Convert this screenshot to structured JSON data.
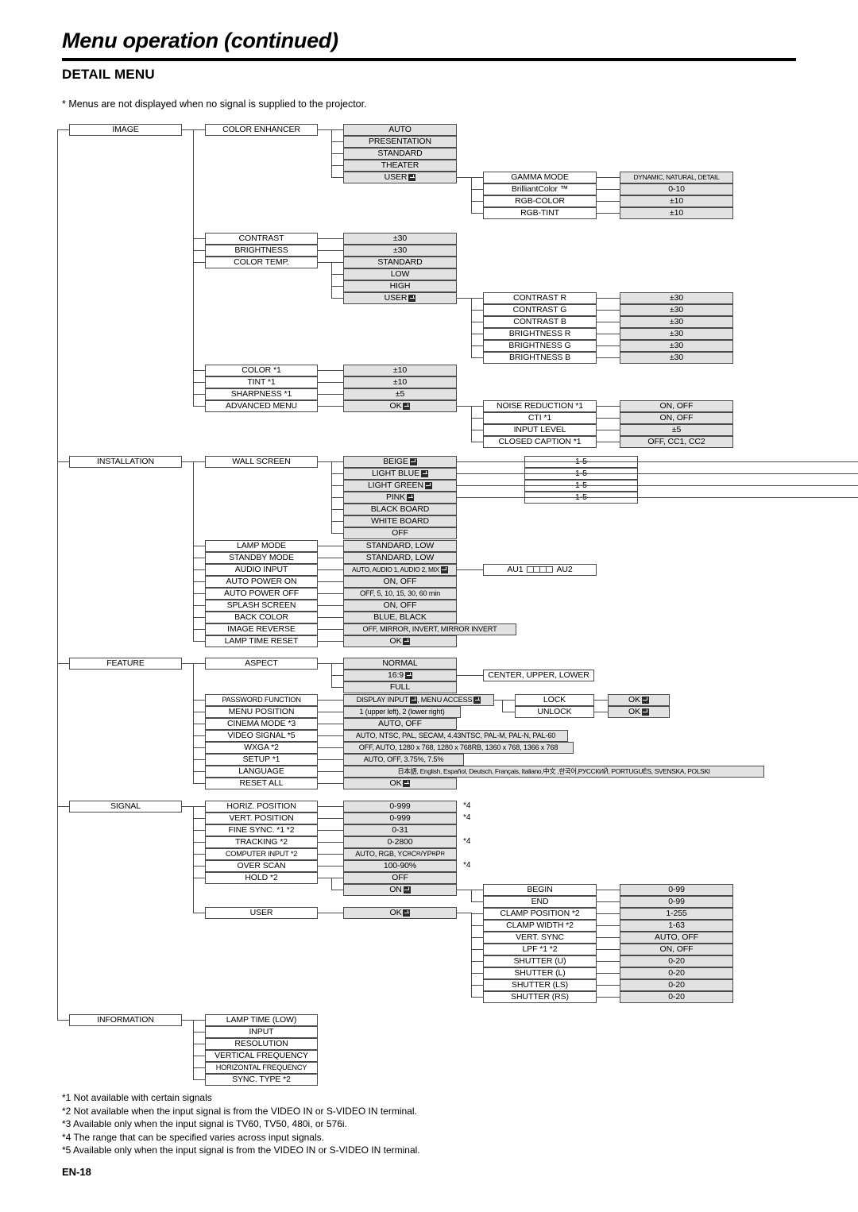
{
  "header": {
    "title": "Menu operation (continued)",
    "section": "DETAIL MENU",
    "note": "* Menus are not displayed when no signal is supplied to the projector."
  },
  "footer": {
    "page_number": "EN-18"
  },
  "footnotes": [
    "*1 Not available with certain signals",
    "*2 Not available when the input signal is from the VIDEO IN or S-VIDEO IN terminal.",
    "*3 Available only when the input signal is TV60, TV50, 480i, or 576i.",
    "*4 The range that can be specified varies across input signals.",
    "*5 Available only when the input signal is from the VIDEO IN or S-VIDEO IN terminal."
  ],
  "menus": {
    "image": {
      "label": "IMAGE",
      "items": {
        "color_enhancer": "COLOR ENHANCER",
        "contrast": "CONTRAST",
        "brightness": "BRIGHTNESS",
        "color_temp": "COLOR TEMP.",
        "color": "COLOR *1",
        "tint": "TINT *1",
        "sharpness": "SHARPNESS *1",
        "advanced_menu": "ADVANCED MENU"
      },
      "color_enhancer_options": [
        "AUTO",
        "PRESENTATION",
        "STANDARD",
        "THEATER",
        "USER"
      ],
      "color_enhancer_user": {
        "items": [
          "GAMMA MODE",
          "BrilliantColor ™",
          "RGB-COLOR",
          "RGB-TINT"
        ],
        "values": [
          "DYNAMIC, NATURAL, DETAIL",
          "0-10",
          "±10",
          "±10"
        ]
      },
      "contrast_value": "±30",
      "brightness_value": "±30",
      "color_temp_options": [
        "STANDARD",
        "LOW",
        "HIGH",
        "USER"
      ],
      "color_temp_user": {
        "items": [
          "CONTRAST R",
          "CONTRAST G",
          "CONTRAST B",
          "BRIGHTNESS R",
          "BRIGHTNESS G",
          "BRIGHTNESS B"
        ],
        "values": [
          "±30",
          "±30",
          "±30",
          "±30",
          "±30",
          "±30"
        ]
      },
      "color_value": "±10",
      "tint_value": "±10",
      "sharpness_value": "±5",
      "advanced_menu_value": "OK",
      "advanced_menu_sub": {
        "items": [
          "NOISE REDUCTION *1",
          "CTI *1",
          "INPUT LEVEL",
          "CLOSED CAPTION *1"
        ],
        "values": [
          "ON, OFF",
          "ON, OFF",
          "±5",
          "OFF, CC1, CC2"
        ]
      }
    },
    "installation": {
      "label": "INSTALLATION",
      "items": {
        "wall_screen": "WALL SCREEN",
        "lamp_mode": "LAMP MODE",
        "standby_mode": "STANDBY MODE",
        "audio_input": "AUDIO INPUT",
        "auto_power_on": "AUTO POWER ON",
        "auto_power_off": "AUTO POWER OFF",
        "splash_screen": "SPLASH SCREEN",
        "back_color": "BACK COLOR",
        "image_reverse": "IMAGE REVERSE",
        "lamp_time_reset": "LAMP TIME RESET"
      },
      "wall_screen_options": [
        "BEIGE",
        "LIGHT BLUE",
        "LIGHT GREEN",
        "PINK",
        "BLACK BOARD",
        "WHITE BOARD",
        "OFF"
      ],
      "wall_screen_levels": [
        "1-5",
        "1-5",
        "1-5",
        "1-5"
      ],
      "values": {
        "lamp_mode": "STANDARD, LOW",
        "standby_mode": "STANDARD, LOW",
        "audio_input": "AUTO, AUDIO 1, AUDIO 2, MIX",
        "audio_input_slider": {
          "left": "AU1",
          "right": "AU2"
        },
        "auto_power_on": "ON, OFF",
        "auto_power_off": "OFF, 5, 10, 15, 30, 60 min",
        "splash_screen": "ON, OFF",
        "back_color": "BLUE, BLACK",
        "image_reverse": "OFF, MIRROR, INVERT, MIRROR INVERT",
        "lamp_time_reset": "OK"
      }
    },
    "feature": {
      "label": "FEATURE",
      "items": {
        "aspect": "ASPECT",
        "password_function": "PASSWORD FUNCTION",
        "menu_position": "MENU POSITION",
        "cinema_mode": "CINEMA MODE *3",
        "video_signal": "VIDEO SIGNAL *5",
        "wxga": "WXGA *2",
        "setup": "SETUP *1",
        "language": "LANGUAGE",
        "reset_all": "RESET ALL"
      },
      "aspect_options": [
        "NORMAL",
        "16:9",
        "FULL"
      ],
      "aspect_169_sub": "CENTER, UPPER, LOWER",
      "values": {
        "password_function": "DISPLAY INPUT ⏎, MENU ACCESS ⏎",
        "password_function_part1": "DISPLAY INPUT",
        "password_function_part2": ", MENU ACCESS",
        "menu_position": "1 (upper left),  2 (lower right)",
        "cinema_mode": "AUTO, OFF",
        "video_signal": "AUTO, NTSC, PAL, SECAM, 4.43NTSC, PAL-M, PAL-N, PAL-60",
        "wxga": "OFF, AUTO, 1280 x 768, 1280 x 768RB, 1360 x 768, 1366 x 768",
        "setup": "AUTO, OFF, 3.75%, 7.5%",
        "language": "日本語, English, Español, Deutsch, Français, Italiano,中文 ,한국어,РУССКИЙ, PORTUGUÊS, SVENSKA, POLSKI",
        "reset_all": "OK"
      },
      "password_sub": {
        "items": [
          "LOCK",
          "UNLOCK"
        ],
        "values": [
          "OK",
          "OK"
        ]
      }
    },
    "signal": {
      "label": "SIGNAL",
      "items": {
        "horiz_position": "HORIZ. POSITION",
        "vert_position": "VERT. POSITION",
        "fine_sync": "FINE SYNC. *1 *2",
        "tracking": "TRACKING *2",
        "computer_input": "COMPUTER INPUT *2",
        "over_scan": "OVER SCAN",
        "hold": "HOLD *2",
        "user": "USER"
      },
      "values": {
        "horiz_position": "0-999",
        "vert_position": "0-999",
        "fine_sync": "0-31",
        "tracking": "0-2800",
        "computer_input": "AUTO, RGB, YCBCR/YPBPR",
        "over_scan": "100-90%",
        "hold_off": "OFF",
        "hold_on": "ON",
        "user": "OK"
      },
      "markers": {
        "horiz_position": "*4",
        "vert_position": "*4",
        "tracking": "*4",
        "over_scan": "*4"
      },
      "hold_on_sub": {
        "items": [
          "BEGIN",
          "END"
        ],
        "values": [
          "0-99",
          "0-99"
        ]
      },
      "user_sub": {
        "items": [
          "CLAMP POSITION *2",
          "CLAMP WIDTH *2",
          "VERT. SYNC",
          "LPF *1 *2",
          "SHUTTER (U)",
          "SHUTTER (L)",
          "SHUTTER (LS)",
          "SHUTTER (RS)"
        ],
        "values": [
          "1-255",
          "1-63",
          "AUTO, OFF",
          "ON, OFF",
          "0-20",
          "0-20",
          "0-20",
          "0-20"
        ]
      }
    },
    "information": {
      "label": "INFORMATION",
      "items": [
        "LAMP TIME (LOW)",
        "INPUT",
        "RESOLUTION",
        "VERTICAL FREQUENCY",
        "HORIZONTAL FREQUENCY",
        "SYNC. TYPE *2"
      ]
    }
  }
}
